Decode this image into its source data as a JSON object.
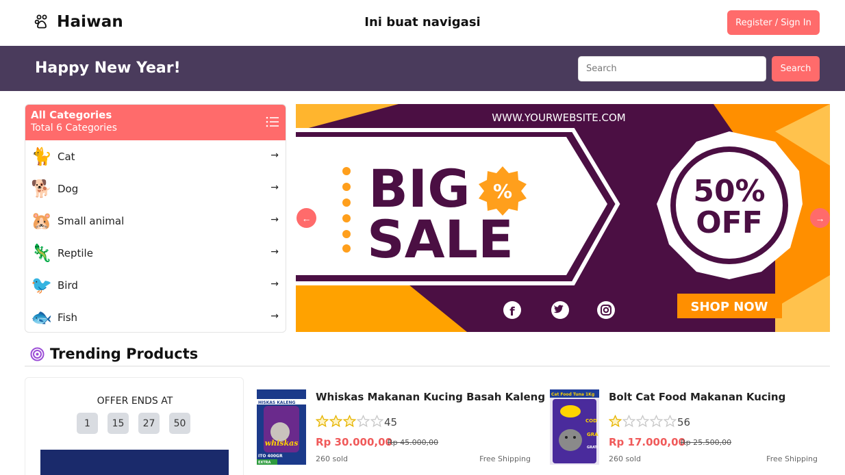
{
  "header": {
    "brand": "Haiwan",
    "nav_text": "Ini buat navigasi",
    "register_label": "Register / Sign In"
  },
  "banner": {
    "greeting": "Happy New Year!",
    "search_placeholder": "Search",
    "search_value": "",
    "search_button": "Search"
  },
  "categories": {
    "title": "All Categories",
    "subtitle": "Total 6 Categories",
    "items": [
      {
        "label": "Cat",
        "icon": "cat-icon",
        "glyph": "🐈"
      },
      {
        "label": "Dog",
        "icon": "dog-icon",
        "glyph": "🐕"
      },
      {
        "label": "Small animal",
        "icon": "hamster-icon",
        "glyph": "🐹"
      },
      {
        "label": "Reptile",
        "icon": "lizard-icon",
        "glyph": "🦎"
      },
      {
        "label": "Bird",
        "icon": "bird-icon",
        "glyph": "🐦"
      },
      {
        "label": "Fish",
        "icon": "fish-icon",
        "glyph": "🐟"
      }
    ]
  },
  "hero": {
    "website": "WWW.YOURWEBSITE.COM",
    "line1": "BIG",
    "line2": "SALE",
    "percent": "%",
    "discount1": "50%",
    "discount2": "OFF",
    "cta": "SHOP NOW"
  },
  "trending": {
    "title": "Trending Products",
    "offer_label": "OFFER ENDS AT",
    "countdown": [
      "1",
      "15",
      "27",
      "50"
    ],
    "products": [
      {
        "name": "Whiskas Makanan Kucing Basah Kaleng",
        "rating_count": "45",
        "stars": 3,
        "price": "Rp 30.000,00",
        "old_price": "Rp 45.000,00",
        "sold": "260 sold",
        "shipping": "Free Shipping",
        "img_texts": [
          "HISKAS KALENG",
          "whiskas",
          "ITO 400GR",
          "EXTRA"
        ]
      },
      {
        "name": "Bolt Cat Food Makanan Kucing",
        "rating_count": "56",
        "stars": 1,
        "price": "Rp 17.000,00",
        "old_price": "Rp 25.500,00",
        "sold": "260 sold",
        "shipping": "Free Shipping",
        "img_texts": [
          "Cat Food Tuna 1Kg",
          "COD",
          "GRA",
          "GRATI"
        ]
      }
    ]
  },
  "colors": {
    "accent": "#ff6b6b",
    "banner_bg": "#4a3b5c",
    "hero_purple": "#4b0f43",
    "hero_orange": "#ffa200"
  }
}
